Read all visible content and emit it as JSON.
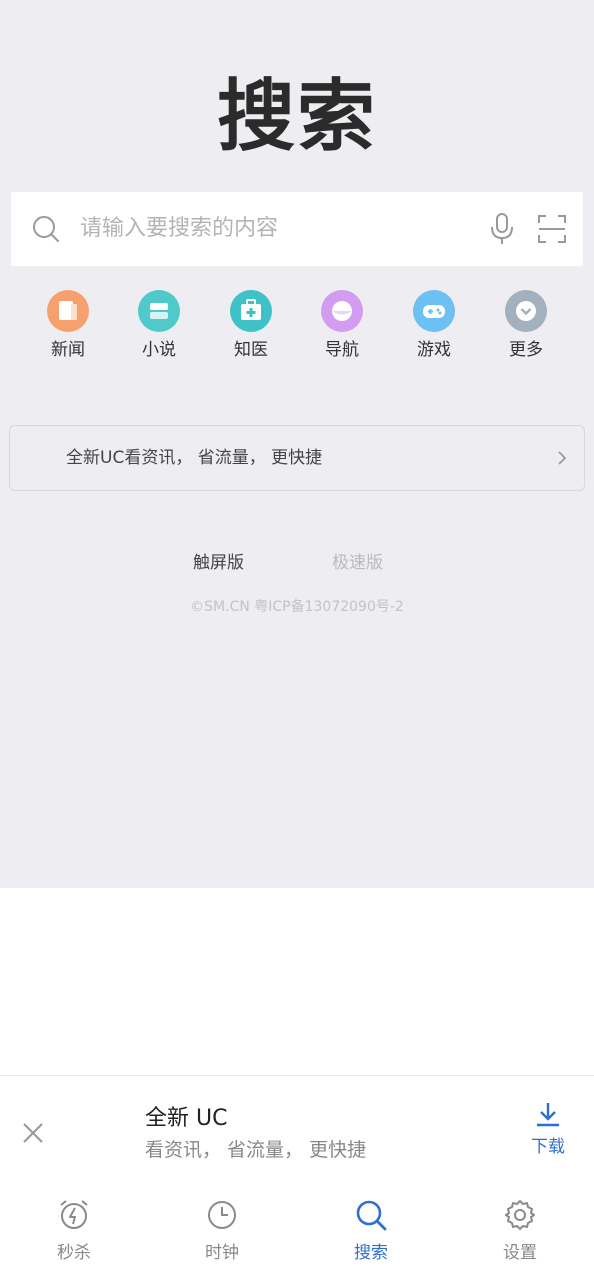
{
  "logo": "搜索",
  "search": {
    "placeholder": "请输入要搜索的内容"
  },
  "quick_links": [
    {
      "label": "新闻",
      "icon": "news-icon",
      "color": "#f6a06d"
    },
    {
      "label": "小说",
      "icon": "novel-icon",
      "color": "#4fc9c9"
    },
    {
      "label": "知医",
      "icon": "medical-icon",
      "color": "#3ec2c8"
    },
    {
      "label": "导航",
      "icon": "navigation-icon",
      "color": "#d39cf0"
    },
    {
      "label": "游戏",
      "icon": "game-icon",
      "color": "#6cc0f2"
    },
    {
      "label": "更多",
      "icon": "more-icon",
      "color": "#a3b0bd"
    }
  ],
  "promo": {
    "text": "全新UC看资讯， 省流量， 更快捷"
  },
  "versions": {
    "touch": "触屏版",
    "fast": "极速版"
  },
  "icp": "©SM.CN 粤ICP备13072090号-2",
  "download_banner": {
    "title": "全新 UC",
    "subtitle": "看资讯， 省流量， 更快捷",
    "download_label": "下载",
    "accent": "#2f6fd0"
  },
  "tabbar": [
    {
      "label": "秒杀",
      "icon": "alarm-clock-icon",
      "active": false
    },
    {
      "label": "时钟",
      "icon": "clock-icon",
      "active": false
    },
    {
      "label": "搜索",
      "icon": "search-icon",
      "active": true
    },
    {
      "label": "设置",
      "icon": "gear-icon",
      "active": false
    }
  ]
}
